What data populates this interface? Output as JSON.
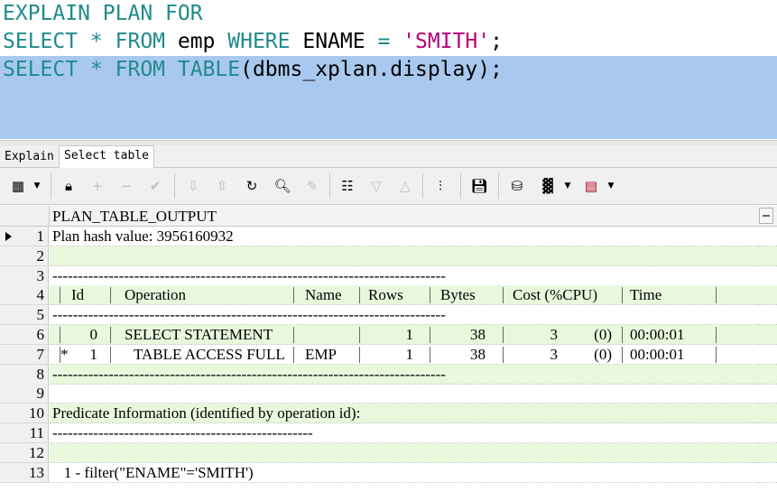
{
  "editor": {
    "lines": [
      {
        "kw1": "EXPLAIN PLAN FOR"
      },
      {
        "kw1": "SELECT * FROM",
        "id1": " emp ",
        "kw2": "WHERE",
        "id2": " ENAME ",
        "kw3": "= ",
        "str": "'SMITH'",
        "id3": ";"
      },
      {
        "kw1": "SELECT * FROM TABLE",
        "id1": "(dbms_xplan.display);"
      }
    ]
  },
  "tabs": [
    {
      "label": "Explain"
    },
    {
      "label": "Select table"
    }
  ],
  "toolbar": {
    "icons": [
      "grid-view-icon",
      "lock-icon",
      "add-record-icon",
      "delete-record-icon",
      "post-changes-icon",
      "next-record-icon",
      "last-record-icon",
      "refresh-icon",
      "find-icon",
      "clear-icon",
      "query-by-example-icon",
      "sort-down-icon",
      "sort-up-icon",
      "tree-icon",
      "save-icon",
      "export-icon",
      "chart-icon",
      "table-view-icon"
    ]
  },
  "grid": {
    "column_header": "PLAN_TABLE_OUTPUT",
    "rows": [
      {
        "num": "1",
        "text": "Plan hash value: 3956160932"
      },
      {
        "num": "2",
        "text": ""
      },
      {
        "num": "3",
        "text": "-----------------------------------------------------------------------------"
      },
      {
        "num": "4",
        "text": "",
        "cols": {
          "id": "Id",
          "operation": "Operation",
          "name": "Name",
          "rows": "Rows",
          "bytes": "Bytes",
          "cost": "Cost (%CPU)",
          "time": "Time"
        }
      },
      {
        "num": "5",
        "text": "-----------------------------------------------------------------------------"
      },
      {
        "num": "6",
        "text": "",
        "cols": {
          "id": "0",
          "operation": "SELECT STATEMENT",
          "name": "",
          "rows": "1",
          "bytes": "38",
          "cost": "3",
          "cpu": "(0)",
          "time": "00:00:01"
        }
      },
      {
        "num": "7",
        "text": "",
        "cols": {
          "star": "*",
          "id": "1",
          "operation": "TABLE ACCESS FULL",
          "name": "EMP",
          "rows": "1",
          "bytes": "38",
          "cost": "3",
          "cpu": "(0)",
          "time": "00:00:01"
        }
      },
      {
        "num": "8",
        "text": "-----------------------------------------------------------------------------"
      },
      {
        "num": "9",
        "text": ""
      },
      {
        "num": "10",
        "text": "Predicate Information (identified by operation id):"
      },
      {
        "num": "11",
        "text": "---------------------------------------------------"
      },
      {
        "num": "12",
        "text": ""
      },
      {
        "num": "13",
        "text": "   1 - filter(\"ENAME\"='SMITH')"
      }
    ]
  },
  "colors": {
    "keyword": "#1f8b8b",
    "string": "#b8007a",
    "selection": "#a9c8ee",
    "row_green": "#e9f8dd"
  }
}
